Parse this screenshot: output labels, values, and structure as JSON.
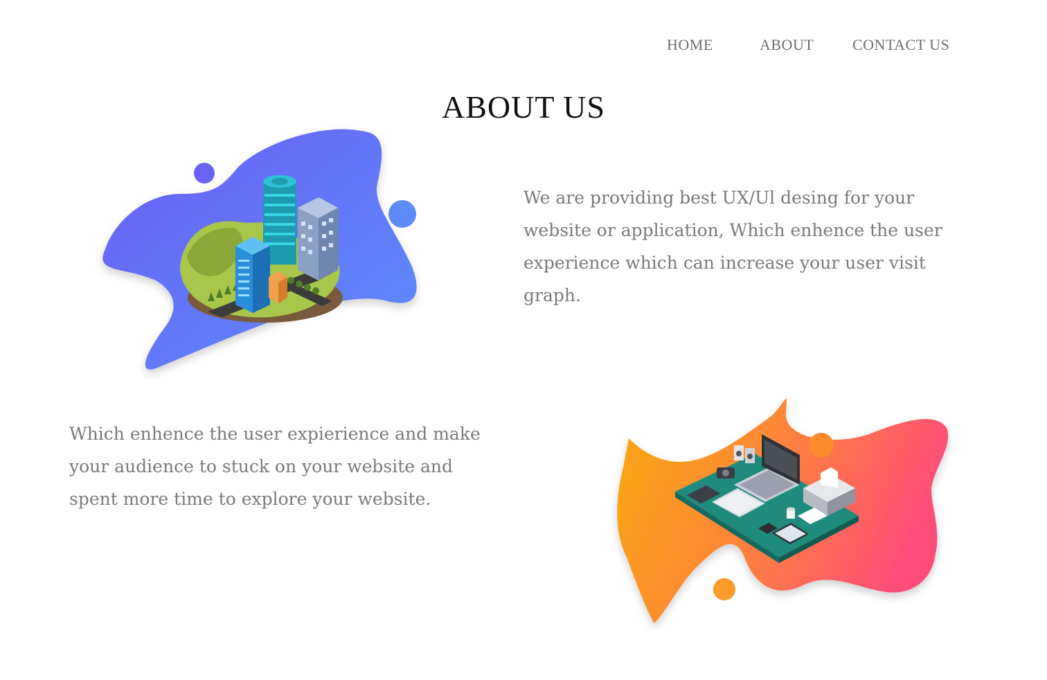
{
  "nav": {
    "items": [
      {
        "label": "HOME"
      },
      {
        "label": "ABOUT"
      },
      {
        "label": "CONTACT US"
      }
    ]
  },
  "page": {
    "title": "ABOUT US"
  },
  "sections": [
    {
      "text": "We are providing best UX/Ul desing for your website or application, Which enhence the user experience which can increase your user visit graph.",
      "illustration": "isometric-city-illustration"
    },
    {
      "text": "Which enhence the user expierience and make your audience to stuck on your website and spent more time to explore your website.",
      "illustration": "isometric-workspace-illustration"
    }
  ],
  "colors": {
    "blob_blue_start": "#6a5ff5",
    "blob_blue_end": "#5c8dfd",
    "blob_orange_start": "#fbaa12",
    "blob_orange_end": "#ff4d7a",
    "nav_text": "#6e6e6e",
    "body_text": "#7a7a7a",
    "title_text": "#111111"
  }
}
